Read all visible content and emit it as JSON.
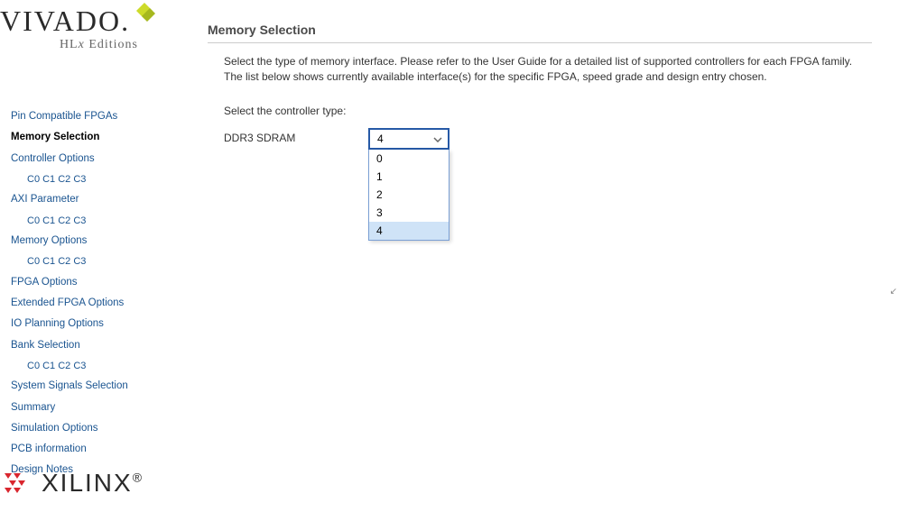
{
  "logo": {
    "vivado": "VIVADO",
    "hlx_prefix": "HL",
    "hlx_x": "x",
    "hlx_suffix": " Editions"
  },
  "sidebar": {
    "items": [
      {
        "label": "Pin Compatible FPGAs",
        "sub": null
      },
      {
        "label": "Memory Selection",
        "sub": null,
        "active": true
      },
      {
        "label": "Controller Options",
        "sub": "C0 C1 C2 C3"
      },
      {
        "label": "AXI Parameter",
        "sub": "C0 C1 C2 C3"
      },
      {
        "label": "Memory Options",
        "sub": "C0 C1 C2 C3"
      },
      {
        "label": "FPGA Options",
        "sub": null
      },
      {
        "label": "Extended FPGA Options",
        "sub": null
      },
      {
        "label": "IO Planning Options",
        "sub": null
      },
      {
        "label": "Bank Selection",
        "sub": "C0 C1 C2 C3"
      },
      {
        "label": "System Signals Selection",
        "sub": null
      },
      {
        "label": "Summary",
        "sub": null
      },
      {
        "label": "Simulation Options",
        "sub": null
      },
      {
        "label": "PCB information",
        "sub": null
      },
      {
        "label": "Design Notes",
        "sub": null
      }
    ]
  },
  "main": {
    "title": "Memory Selection",
    "description": "Select the type of memory interface. Please refer to the User Guide for a detailed list of supported controllers for each FPGA family. The list below shows currently available interface(s) for the specific FPGA, speed grade and design entry chosen.",
    "prompt": "Select the controller type:",
    "field_label": "DDR3 SDRAM",
    "dropdown": {
      "selected": "4",
      "options": [
        "0",
        "1",
        "2",
        "3",
        "4"
      ],
      "highlighted_index": 4
    }
  },
  "footer": {
    "xilinx": "XILINX"
  },
  "colors": {
    "link": "#1a5490",
    "select_border": "#2659a6",
    "highlight": "#cfe3f7"
  }
}
